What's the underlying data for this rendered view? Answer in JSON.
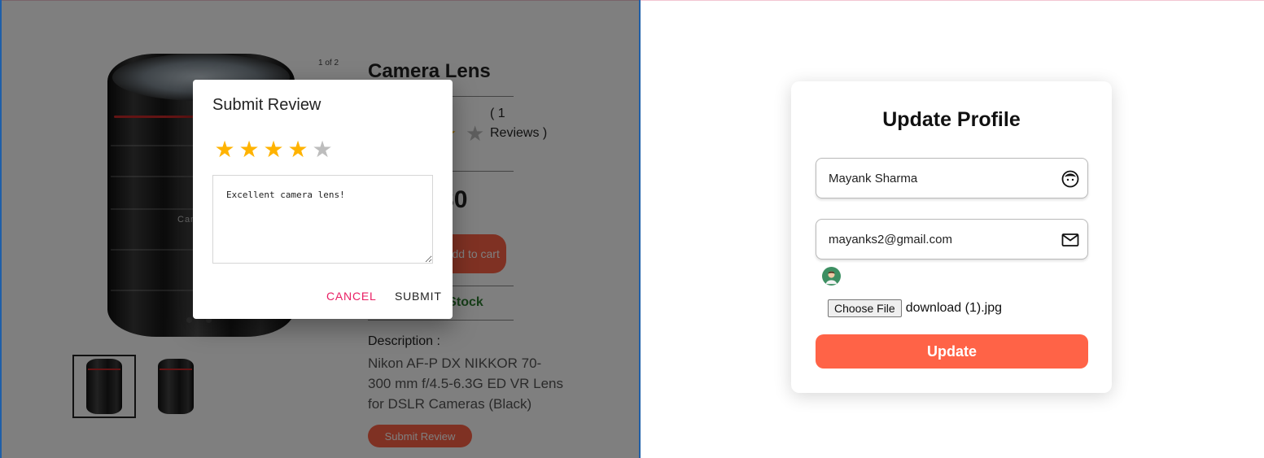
{
  "product": {
    "title": "Camera Lens",
    "image_counter": "1 of 2",
    "review_count": "( 1 Reviews )",
    "price": "₹30",
    "add_to_cart": "Add to cart",
    "stock_status": "InStock",
    "description_label": "Description :",
    "description": "Nikon AF-P DX NIKKOR 70-300 mm f/4.5-6.3G ED VR Lens for DSLR Cameras (Black)",
    "submit_review": "Submit Review",
    "lens_brand_text": "Canon",
    "rating": 4,
    "rating_max": 5
  },
  "dialog": {
    "title": "Submit Review",
    "rating": 4,
    "rating_max": 5,
    "review_text": "Excellent camera lens!",
    "cancel": "CANCEL",
    "submit": "SUBMIT"
  },
  "profile": {
    "title": "Update Profile",
    "name": "Mayank Sharma",
    "email": "mayanks2@gmail.com",
    "choose_file": "Choose File",
    "file_name": "download (1).jpg",
    "update": "Update"
  },
  "icons": {
    "name_field": "face-icon",
    "email_field": "mail-icon",
    "star": "star-icon"
  },
  "colors": {
    "accent": "#ff6347",
    "star_on": "#ffb300",
    "star_off": "#bdbdbd",
    "cancel": "#e91e63",
    "in_stock": "#2e7d32"
  }
}
